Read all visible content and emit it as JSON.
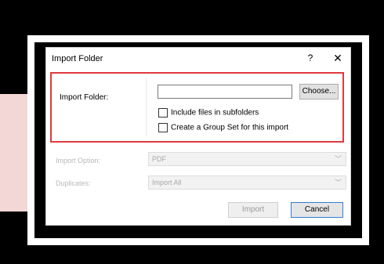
{
  "dialog": {
    "title": "Import Folder",
    "help": "?",
    "close": "✕"
  },
  "folder": {
    "label": "Import Folder:",
    "value": "",
    "choose_label": "Choose..."
  },
  "checkboxes": [
    {
      "label": "Include files in subfolders",
      "checked": false
    },
    {
      "label": "Create a Group Set for this import",
      "checked": false
    }
  ],
  "import_option": {
    "label": "Import Option:",
    "value": "PDF"
  },
  "duplicates": {
    "label": "Duplicates:",
    "value": "Import All"
  },
  "buttons": {
    "import": "Import",
    "cancel": "Cancel"
  },
  "colors": {
    "highlight": "#e0393e",
    "default_button_border": "#2f7ed8"
  }
}
